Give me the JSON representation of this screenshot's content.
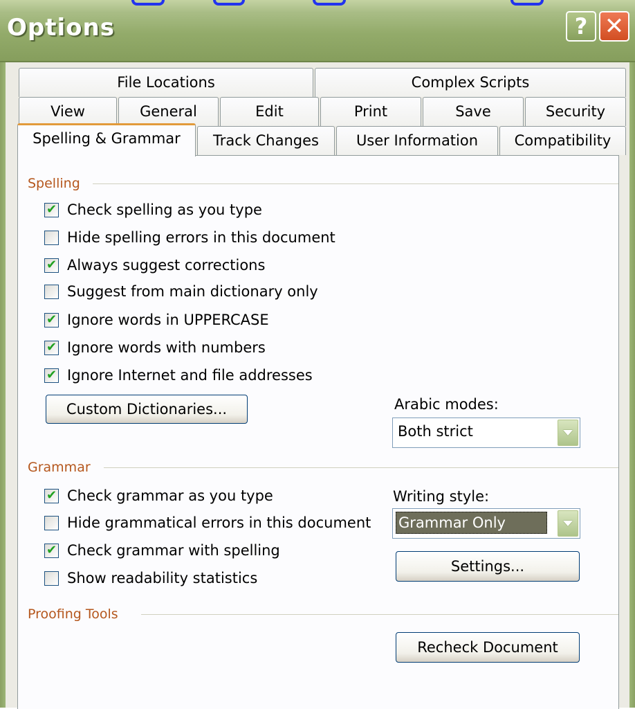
{
  "window": {
    "title": "Options",
    "help_symbol": "?",
    "close_symbol": "✕"
  },
  "tabs": {
    "row1": [
      "File Locations",
      "Complex Scripts"
    ],
    "row2": [
      "View",
      "General",
      "Edit",
      "Print",
      "Save",
      "Security"
    ],
    "row3": [
      "Spelling & Grammar",
      "Track Changes",
      "User Information",
      "Compatibility"
    ],
    "active": "Spelling & Grammar"
  },
  "spelling": {
    "heading": "Spelling",
    "options": [
      {
        "label": "Check spelling as you type",
        "checked": true
      },
      {
        "label": "Hide spelling errors in this document",
        "checked": false
      },
      {
        "label": "Always suggest corrections",
        "checked": true
      },
      {
        "label": "Suggest from main dictionary only",
        "checked": false
      },
      {
        "label": "Ignore words in UPPERCASE",
        "checked": true
      },
      {
        "label": "Ignore words with numbers",
        "checked": true
      },
      {
        "label": "Ignore Internet and file addresses",
        "checked": true
      }
    ],
    "custom_dictionaries_button": "Custom Dictionaries...",
    "arabic_modes_label": "Arabic modes:",
    "arabic_modes_value": "Both strict"
  },
  "grammar": {
    "heading": "Grammar",
    "options": [
      {
        "label": "Check grammar as you type",
        "checked": true
      },
      {
        "label": "Hide grammatical errors in this document",
        "checked": false
      },
      {
        "label": "Check grammar with spelling",
        "checked": true
      },
      {
        "label": "Show readability statistics",
        "checked": false
      }
    ],
    "writing_style_label": "Writing style:",
    "writing_style_value": "Grammar Only",
    "settings_button": "Settings..."
  },
  "proofing": {
    "heading": "Proofing Tools",
    "recheck_button": "Recheck Document"
  },
  "colors": {
    "titlebar": "#93ab6a",
    "section_heading": "#b5571d",
    "active_tab_accent": "#e29a3a",
    "check_mark": "#21a121",
    "highlight": "#6e6e5a"
  }
}
